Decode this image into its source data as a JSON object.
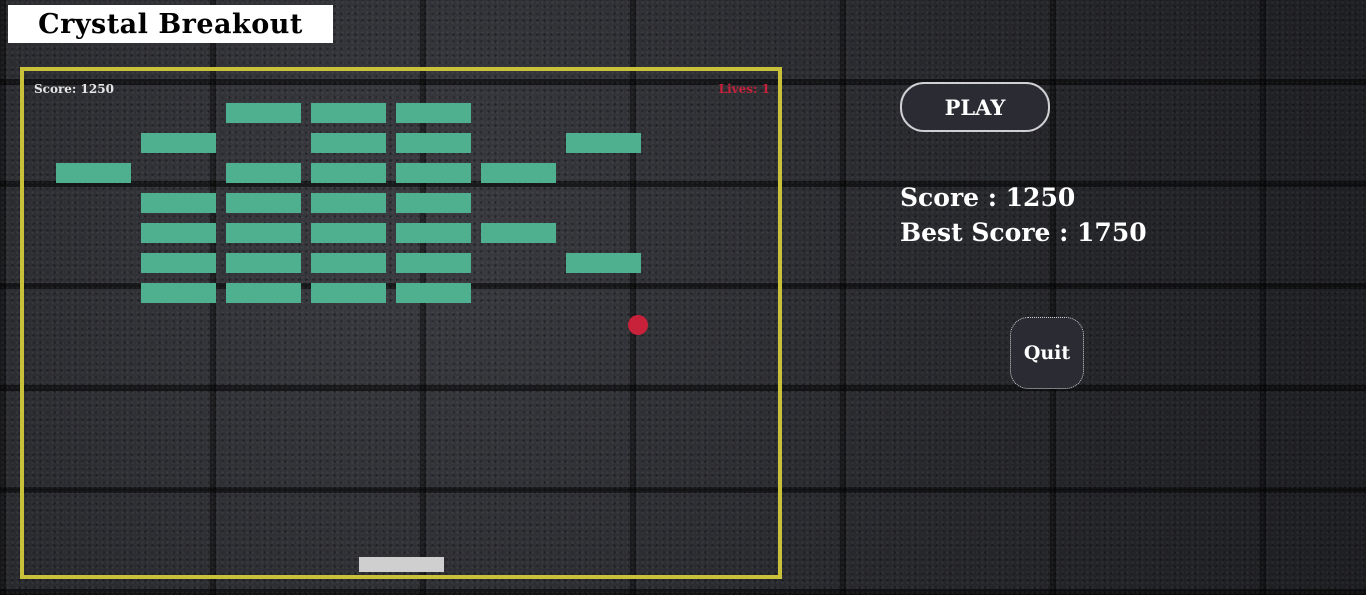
{
  "page_title": "Crystal Breakout",
  "hud": {
    "score_text": "Score: 1250",
    "lives_text": "Lives: 1"
  },
  "buttons": {
    "play_label": "PLAY",
    "quit_label": "Quit"
  },
  "stats": {
    "score_text": "Score : 1250",
    "best_score_text": "Best Score : 1750"
  },
  "colors": {
    "frame": "#c9c13a",
    "brick": "#4fb08f",
    "ball": "#c8213a",
    "paddle": "#cfcfcf",
    "lives": "#c8213a"
  },
  "bricks": {
    "columns": 8,
    "rows": 7,
    "visible_grid": [
      [
        0,
        0,
        1,
        1,
        1,
        0,
        0,
        0
      ],
      [
        0,
        1,
        0,
        1,
        1,
        0,
        1,
        0
      ],
      [
        1,
        0,
        1,
        1,
        1,
        1,
        0,
        0
      ],
      [
        0,
        1,
        1,
        1,
        1,
        0,
        0,
        0
      ],
      [
        0,
        1,
        1,
        1,
        1,
        1,
        0,
        0
      ],
      [
        0,
        1,
        1,
        1,
        1,
        0,
        1,
        0
      ],
      [
        0,
        1,
        1,
        1,
        1,
        0,
        0,
        0
      ]
    ]
  }
}
